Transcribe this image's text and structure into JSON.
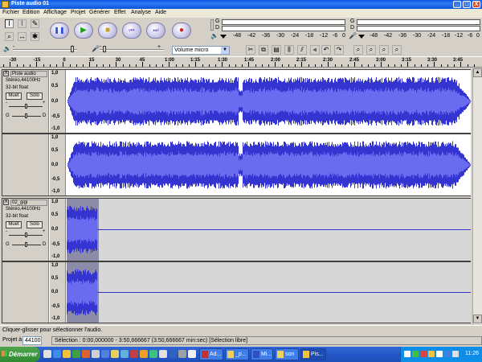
{
  "window": {
    "title": "Piste audio 01",
    "minimize": "_",
    "maximize": "□",
    "close": "X"
  },
  "menu": [
    "Fichier",
    "Edition",
    "Affichage",
    "Projet",
    "Générer",
    "Effet",
    "Analyse",
    "Aide"
  ],
  "tools": {
    "select": "I",
    "envelope": "⌇",
    "draw": "✎",
    "zoom": "⌕",
    "timeshift": "↔",
    "multi": "✱"
  },
  "transport": {
    "pause": "❚❚",
    "play": "▶",
    "stop": "■",
    "skip_start": "⏮",
    "skip_end": "⏭",
    "record": "●"
  },
  "meters": {
    "play_letters": [
      "G",
      "D"
    ],
    "rec_letters": [
      "G",
      "D"
    ],
    "scale": [
      "-48",
      "-42",
      "-36",
      "-30",
      "-24",
      "-18",
      "-12",
      "-6",
      "0",
      "-48",
      "-42",
      "-36",
      "-30",
      "-24",
      "-18",
      "-12",
      "-6",
      "0"
    ]
  },
  "mixer": {
    "minus": "-",
    "plus": "+",
    "input_select": "Volume micro",
    "input_arrow": "▼"
  },
  "edit_tools": [
    "✂",
    "⧉",
    "▤",
    "⫼",
    "⫽",
    "⫷",
    "↶",
    "↷",
    "⌕",
    "⌕",
    "⌕",
    "⌕"
  ],
  "ruler": [
    "-30",
    "-15",
    "0",
    "15",
    "30",
    "45",
    "1:00",
    "1:15",
    "1:30",
    "1:45",
    "2:00",
    "2:15",
    "2:30",
    "2:45",
    "3:00",
    "3:15",
    "3:30",
    "3:45"
  ],
  "tracks": [
    {
      "name": "Piste audio",
      "format": "Stéréo,44100Hz",
      "bits": "32-bit float",
      "mute": "Muet",
      "solo": "Solo",
      "gain_minus": "-",
      "gain_plus": "+",
      "pan_left": "G",
      "pan_right": "D",
      "yaxis": [
        "1,0",
        "0,5",
        "0,0",
        "-0,5",
        "-1,0"
      ],
      "selected": false,
      "coverage": 1.0,
      "close_glyph": "X"
    },
    {
      "name": "02_gigi",
      "format": "Stéréo,44100Hz",
      "bits": "32-bit float",
      "mute": "Muet",
      "solo": "Solo",
      "gain_minus": "-",
      "gain_plus": "+",
      "pan_left": "G",
      "pan_right": "D",
      "yaxis": [
        "1,0",
        "0,5",
        "0,0",
        "-0,5",
        "-1,0"
      ],
      "selected": true,
      "coverage": 0.075,
      "close_glyph": "X"
    }
  ],
  "scroll": {
    "up": "▲",
    "down": "▼"
  },
  "status": "Cliquer-glisser pour sélectionner l'audio.",
  "bottom": {
    "rate_label": "Projet à",
    "rate": "44100",
    "selection": "Sélection : 0:00,000000 - 3:50,666667 (3:50,666667 min:sec)  [Sélection libre]"
  },
  "taskbar": {
    "start": "Démarrer",
    "tasks": [
      "Ad...",
      "_p...",
      "Mi...",
      "son",
      "Pis..."
    ],
    "clock": "11:26"
  },
  "colors": {
    "wave": "#3434d0",
    "wave_light": "#6b6bf0",
    "selection": "#8c8ca8",
    "unselected_bg": "#d7d7d7"
  }
}
